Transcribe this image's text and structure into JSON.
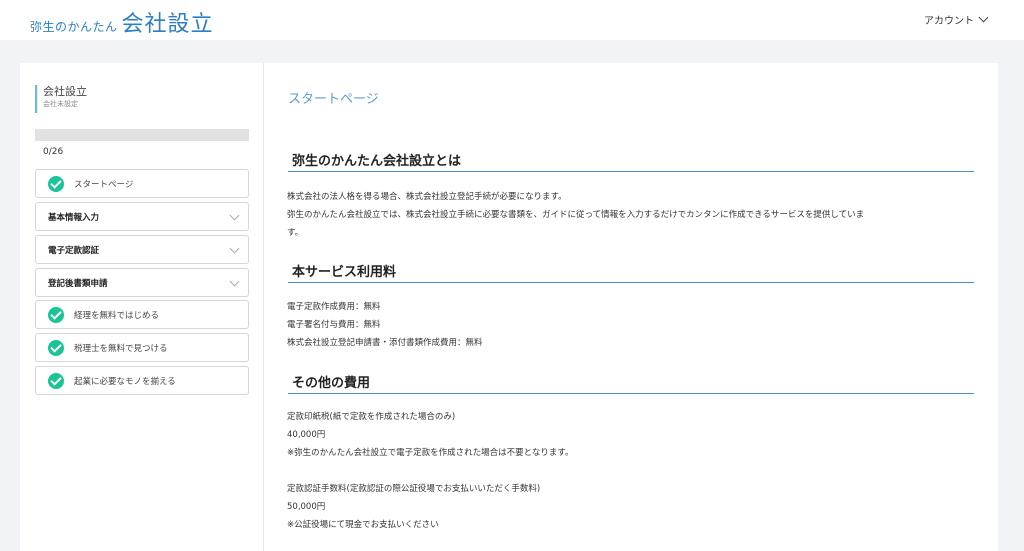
{
  "header": {
    "logo_small": "弥生のかんたん",
    "logo_big": "会社設立",
    "account_label": "アカウント"
  },
  "sidebar": {
    "company_name": "会社設立",
    "company_status": "会社未設定",
    "progress": {
      "value": 0,
      "total": 26,
      "text": "0/26"
    },
    "items": [
      {
        "label": "スタートページ",
        "type": "check"
      },
      {
        "label": "基本情報入力",
        "type": "section"
      },
      {
        "label": "電子定款認証",
        "type": "section"
      },
      {
        "label": "登記後書類申請",
        "type": "section"
      },
      {
        "label": "経理を無料ではじめる",
        "type": "check"
      },
      {
        "label": "税理士を無料で見つける",
        "type": "check"
      },
      {
        "label": "起業に必要なモノを揃える",
        "type": "check"
      }
    ]
  },
  "main": {
    "page_title": "スタートページ",
    "sections": [
      {
        "heading": "弥生のかんたん会社設立とは",
        "lines": [
          "株式会社の法人格を得る場合、株式会社設立登記手続が必要になります。",
          "弥生のかんたん会社設立では、株式会社設立手続に必要な書類を、ガイドに従って情報を入力するだけでカンタンに作成できるサービスを提供していま",
          "す。"
        ]
      },
      {
        "heading": "本サービス利用料",
        "lines": [
          "電子定款作成費用：無料",
          "電子署名付与費用：無料",
          "株式会社設立登記申請書・添付書類作成費用：無料"
        ]
      },
      {
        "heading": "その他の費用",
        "lines": [
          "定款印紙税(紙で定款を作成された場合のみ)",
          "40,000円",
          "※弥生のかんたん会社設立で電子定款を作成された場合は不要となります。",
          "",
          "定款認証手数料(定款認証の際公証役場でお支払いいただく手数料)",
          "50,000円",
          "※公証役場にて現金でお支払いください"
        ]
      }
    ]
  }
}
